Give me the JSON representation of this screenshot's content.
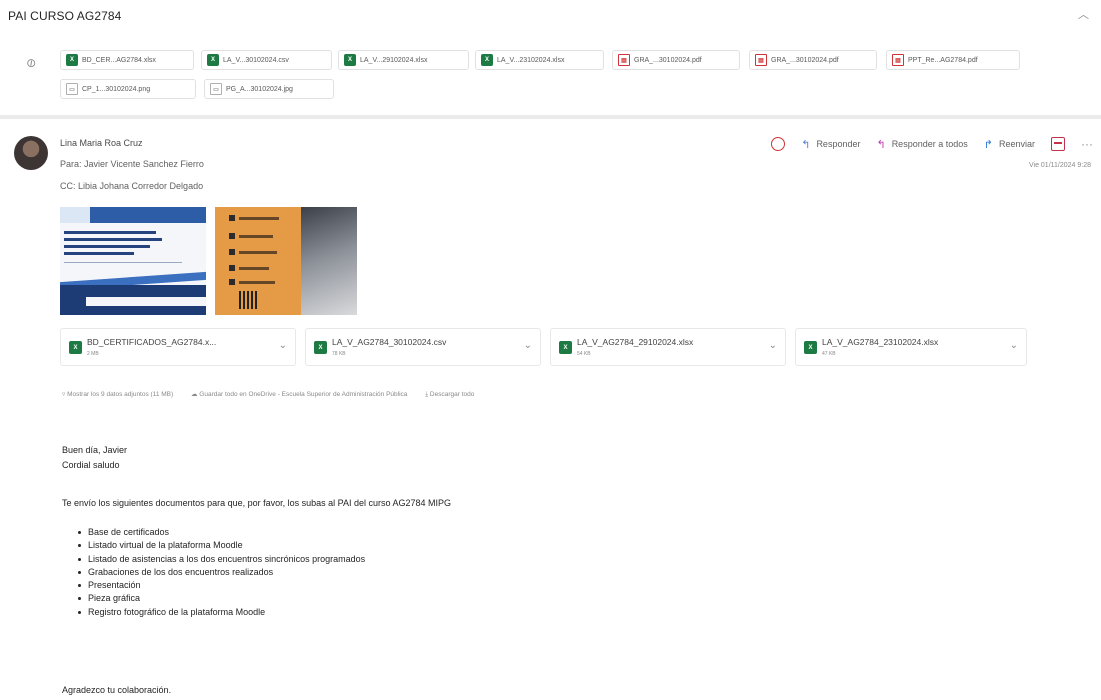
{
  "subject": "PAI CURSO AG2784",
  "thread_attachments": [
    {
      "type": "xls",
      "name": "BD_CER...AG2784.xlsx"
    },
    {
      "type": "xls",
      "name": "LA_V...30102024.csv"
    },
    {
      "type": "xls",
      "name": "LA_V...29102024.xlsx"
    },
    {
      "type": "xls",
      "name": "LA_V...23102024.xlsx"
    },
    {
      "type": "pdf",
      "name": "GRA_...30102024.pdf"
    },
    {
      "type": "pdf",
      "name": "GRA_...30102024.pdf"
    },
    {
      "type": "pdf",
      "name": "PPT_Re...AG2784.pdf"
    },
    {
      "type": "img",
      "name": "CP_1...30102024.png"
    },
    {
      "type": "img",
      "name": "PG_A...30102024.jpg"
    }
  ],
  "message": {
    "sender": "Lina Maria Roa Cruz",
    "to": "Para: Javier Vicente Sanchez Fierro",
    "cc": "CC: Libia Johana Corredor Delgado",
    "timestamp": "Vie 01/11/2024 9:28",
    "actions": {
      "reply": "Responder",
      "reply_all": "Responder a todos",
      "forward": "Reenviar"
    }
  },
  "attachments": [
    {
      "type": "xls",
      "name": "BD_CERTIFICADOS_AG2784.x...",
      "size": "2 MB"
    },
    {
      "type": "xls",
      "name": "LA_V_AG2784_30102024.csv",
      "size": "78 KB"
    },
    {
      "type": "xls",
      "name": "LA_V_AG2784_29102024.xlsx",
      "size": "54 KB"
    },
    {
      "type": "xls",
      "name": "LA_V_AG2784_23102024.xlsx",
      "size": "47 KB"
    }
  ],
  "attachment_actions": {
    "show_all": "Mostrar los 9 datos adjuntos (11 MB)",
    "save_onedrive": "Guardar todo en OneDrive - Escuela Superior de Administración Pública",
    "download_all": "Descargar todo"
  },
  "body": {
    "greeting": "Buen día, Javier",
    "salutation": "Cordial saludo",
    "intro": "Te envío los siguientes documentos para que, por favor, los subas al PAI del curso AG2784 MIPG",
    "items": [
      "Base de certificados",
      "Listado virtual de la plataforma Moodle",
      "Listado de asistencias a los dos encuentros sincrónicos programados",
      "Grabaciones de los dos encuentros realizados",
      "Presentación",
      "Pieza gráfica",
      "Registro fotográfico de la plataforma Moodle"
    ],
    "closing": "Agradezco tu colaboración."
  },
  "icons": {
    "paperclip": "paperclip-icon",
    "collapse": "chevron-up-icon",
    "react": "emoji-icon",
    "reply": "reply-icon",
    "reply_all": "reply-all-icon",
    "forward": "forward-icon",
    "calendar": "calendar-icon",
    "more": "more-icon"
  },
  "colors": {
    "excel": "#1d7a43",
    "pdf": "#d13438",
    "reply_all": "#c239b3",
    "forward": "#2b7cd3"
  }
}
